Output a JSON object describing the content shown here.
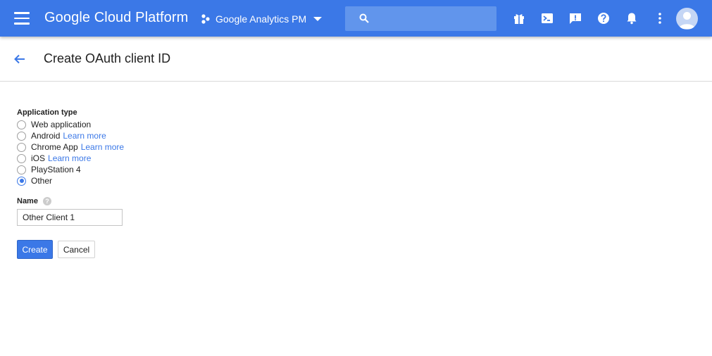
{
  "topbar": {
    "brand": "Google Cloud Platform",
    "project_name": "Google Analytics PM",
    "search_placeholder": "",
    "icons": [
      "menu-icon",
      "project-icon",
      "search-icon",
      "gift-icon",
      "cloud-shell-icon",
      "feedback-icon",
      "help-icon",
      "notifications-icon",
      "more-vert-icon",
      "account-avatar"
    ],
    "accent": "#3b78e7"
  },
  "header": {
    "title": "Create OAuth client ID"
  },
  "form": {
    "app_type_label": "Application type",
    "options": [
      {
        "label": "Web application",
        "link": "",
        "checked": false
      },
      {
        "label": "Android",
        "link": "Learn more",
        "checked": false
      },
      {
        "label": "Chrome App",
        "link": "Learn more",
        "checked": false
      },
      {
        "label": "iOS",
        "link": "Learn more",
        "checked": false
      },
      {
        "label": "PlayStation 4",
        "link": "",
        "checked": false
      },
      {
        "label": "Other",
        "link": "",
        "checked": true
      }
    ],
    "name_label": "Name",
    "help_glyph": "?",
    "name_value": "Other Client 1",
    "create_label": "Create",
    "cancel_label": "Cancel"
  }
}
